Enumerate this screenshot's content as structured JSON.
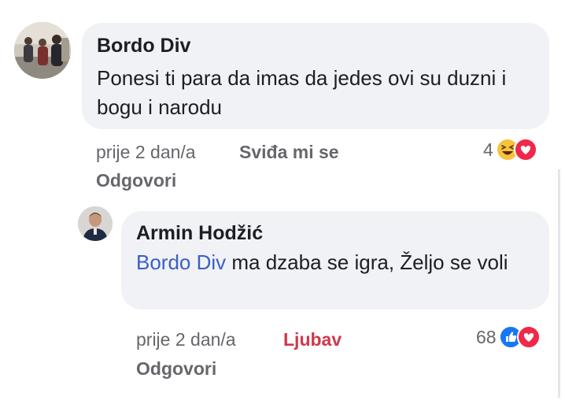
{
  "comments": [
    {
      "author": "Bordo Div",
      "text": "Ponesi ti para da imas da jedes ovi su duzni i bogu i narodu",
      "time": "prije 2 dan/a",
      "reaction_label": "Sviđa mi se",
      "reply_label": "Odgovori",
      "reaction_count": "4",
      "reaction_icons": [
        "haha-icon",
        "love-icon"
      ]
    },
    {
      "author": "Armin Hodžić",
      "mention": "Bordo Div",
      "text": " ma dzaba se igra, Željo se voli",
      "time": "prije 2 dan/a",
      "reaction_label": "Ljubav",
      "reply_label": "Odgovori",
      "reaction_count": "68",
      "reaction_icons": [
        "like-icon",
        "love-icon"
      ]
    }
  ],
  "colors": {
    "bubble": "#f0f2f5",
    "mention": "#3b5ec6",
    "love_reaction": "#d1374b",
    "meta": "#65676b"
  }
}
